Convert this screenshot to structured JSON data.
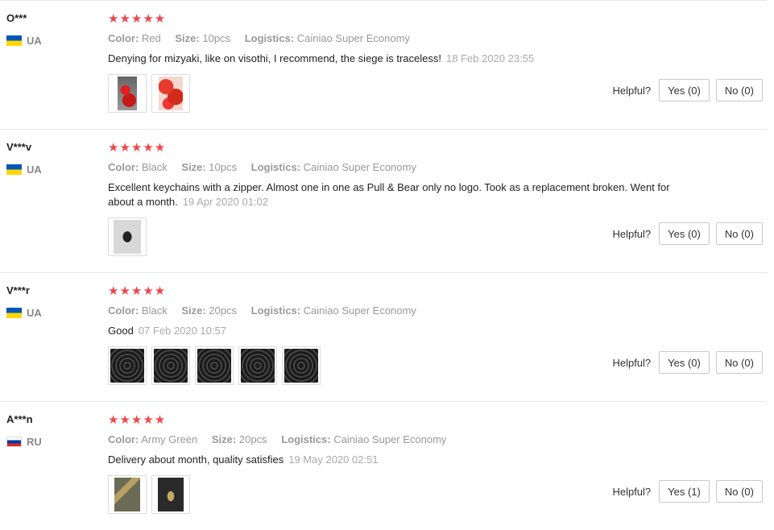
{
  "helpful_label": "Helpful?",
  "reviews": [
    {
      "user": "O***",
      "country": "UA",
      "stars": "★★★★★",
      "color_label": "Color:",
      "color": "Red",
      "size_label": "Size:",
      "size": "10pcs",
      "logistics_label": "Logistics:",
      "logistics": "Cainiao Super Economy",
      "text": "Denying for mizyaki, like on visothi, I recommend, the siege is traceless!",
      "date": "18 Feb 2020 23:55",
      "yes": "Yes (0)",
      "no": "No (0)"
    },
    {
      "user": "V***v",
      "country": "UA",
      "stars": "★★★★★",
      "color_label": "Color:",
      "color": "Black",
      "size_label": "Size:",
      "size": "10pcs",
      "logistics_label": "Logistics:",
      "logistics": "Cainiao Super Economy",
      "text": "Excellent keychains with a zipper. Almost one in one as Pull & Bear only no logo. Took as a replacement broken. Went for about a month.",
      "date": "19 Apr 2020 01:02",
      "yes": "Yes (0)",
      "no": "No (0)"
    },
    {
      "user": "V***r",
      "country": "UA",
      "stars": "★★★★★",
      "color_label": "Color:",
      "color": "Black",
      "size_label": "Size:",
      "size": "20pcs",
      "logistics_label": "Logistics:",
      "logistics": "Cainiao Super Economy",
      "text": "Good",
      "date": "07 Feb 2020 10:57",
      "yes": "Yes (0)",
      "no": "No (0)"
    },
    {
      "user": "A***n",
      "country": "RU",
      "stars": "★★★★★",
      "color_label": "Color:",
      "color": "Army Green",
      "size_label": "Size:",
      "size": "20pcs",
      "logistics_label": "Logistics:",
      "logistics": "Cainiao Super Economy",
      "text": "Delivery about month, quality satisfies",
      "date": "19 May 2020 02:51",
      "yes": "Yes (1)",
      "no": "No (0)"
    }
  ]
}
